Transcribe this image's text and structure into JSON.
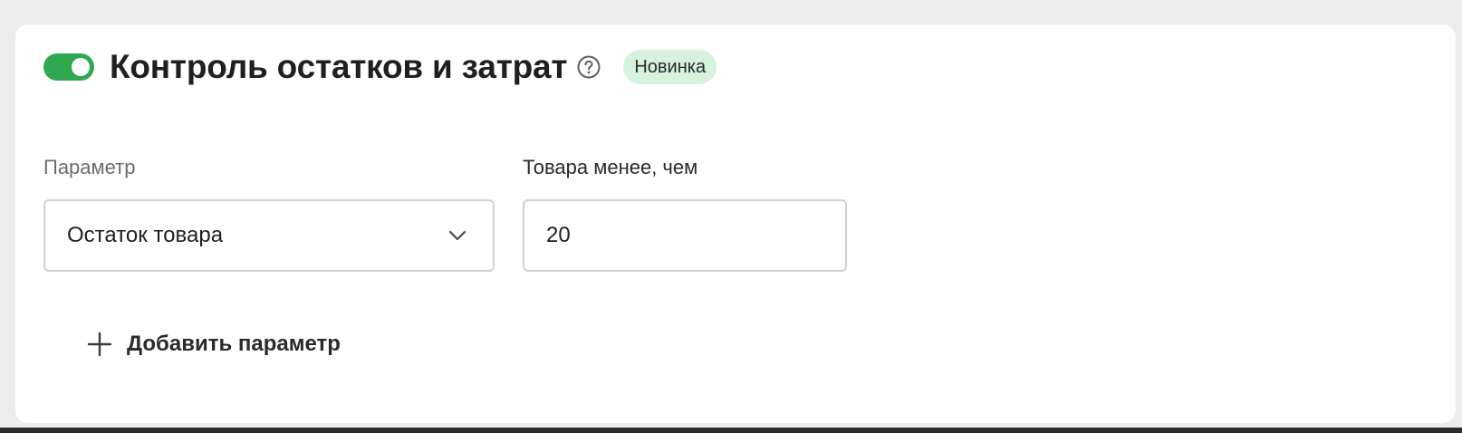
{
  "section": {
    "enabled": true,
    "title": "Контроль остатков и затрат",
    "badge": "Новинка",
    "toggle_color": "#2fa84f",
    "badge_color": "#d6f2dd",
    "help_icon": "question-circle-icon"
  },
  "fields": {
    "parameter_label": "Параметр",
    "parameter_value": "Остаток товара",
    "threshold_label": "Товара менее, чем",
    "threshold_value": "20"
  },
  "actions": {
    "add_parameter_label": "Добавить параметр",
    "add_icon": "plus-icon"
  }
}
